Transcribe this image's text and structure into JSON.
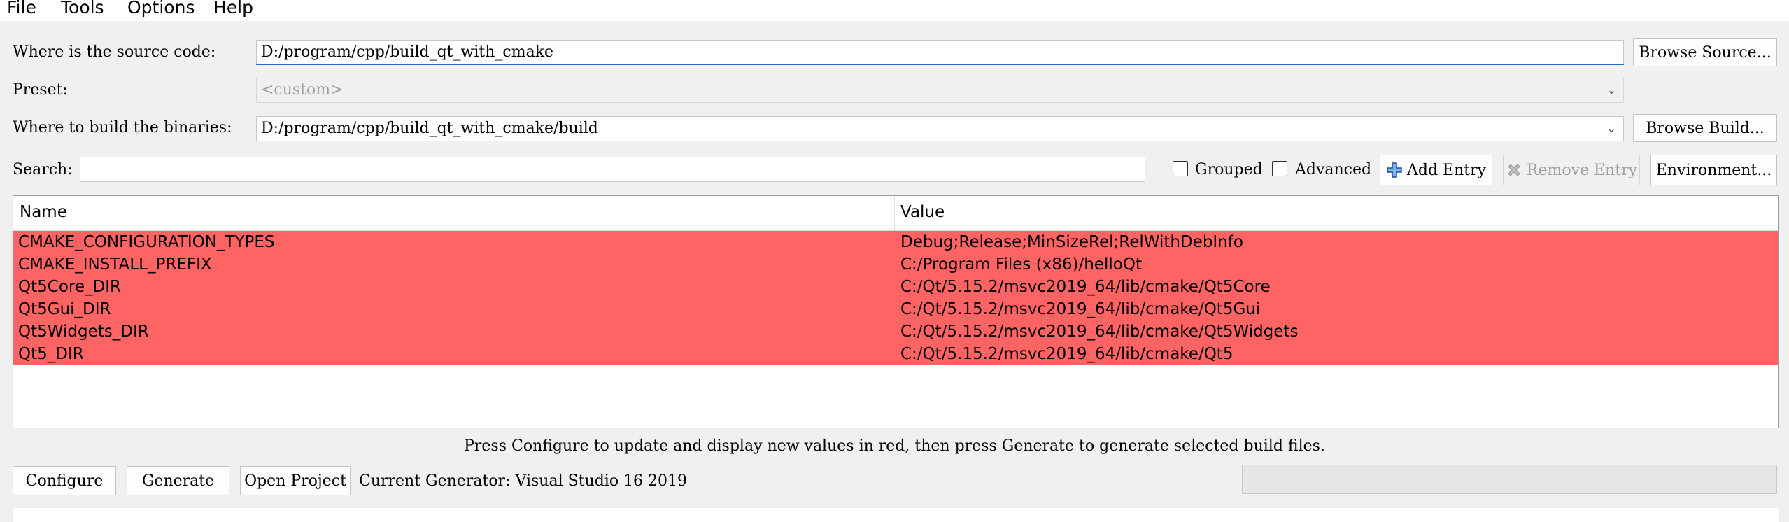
{
  "menu": {
    "file": "File",
    "tools": "Tools",
    "options": "Options",
    "help": "Help"
  },
  "source": {
    "label": "Where is the source code:",
    "value": "D:/program/cpp/build_qt_with_cmake",
    "browse_label": "Browse Source..."
  },
  "preset": {
    "label": "Preset:",
    "value": "<custom>"
  },
  "build": {
    "label": "Where to build the binaries:",
    "value": "D:/program/cpp/build_qt_with_cmake/build",
    "browse_label": "Browse Build..."
  },
  "search": {
    "label": "Search:",
    "value": "",
    "grouped_label": "Grouped",
    "grouped_checked": false,
    "advanced_label": "Advanced",
    "advanced_checked": false,
    "add_entry_label": "Add Entry",
    "remove_entry_label": "Remove Entry",
    "environment_label": "Environment..."
  },
  "table": {
    "headers": [
      "Name",
      "Value"
    ],
    "row_color": "#ff6464",
    "rows": [
      {
        "name": "CMAKE_CONFIGURATION_TYPES",
        "value": "Debug;Release;MinSizeRel;RelWithDebInfo"
      },
      {
        "name": "CMAKE_INSTALL_PREFIX",
        "value": "C:/Program Files (x86)/helloQt"
      },
      {
        "name": "Qt5Core_DIR",
        "value": "C:/Qt/5.15.2/msvc2019_64/lib/cmake/Qt5Core"
      },
      {
        "name": "Qt5Gui_DIR",
        "value": "C:/Qt/5.15.2/msvc2019_64/lib/cmake/Qt5Gui"
      },
      {
        "name": "Qt5Widgets_DIR",
        "value": "C:/Qt/5.15.2/msvc2019_64/lib/cmake/Qt5Widgets"
      },
      {
        "name": "Qt5_DIR",
        "value": "C:/Qt/5.15.2/msvc2019_64/lib/cmake/Qt5"
      }
    ]
  },
  "hint": "Press Configure to update and display new values in red, then press Generate to generate selected build files.",
  "actions": {
    "configure_label": "Configure",
    "generate_label": "Generate",
    "open_project_label": "Open Project",
    "current_generator": "Current Generator: Visual Studio 16 2019"
  },
  "icons": {
    "add": "plus-icon",
    "remove": "x-icon",
    "dropdown": "chevron-down-icon"
  },
  "colors": {
    "changed_row": "#ff6464",
    "focus_accent": "#1f6fc5"
  }
}
